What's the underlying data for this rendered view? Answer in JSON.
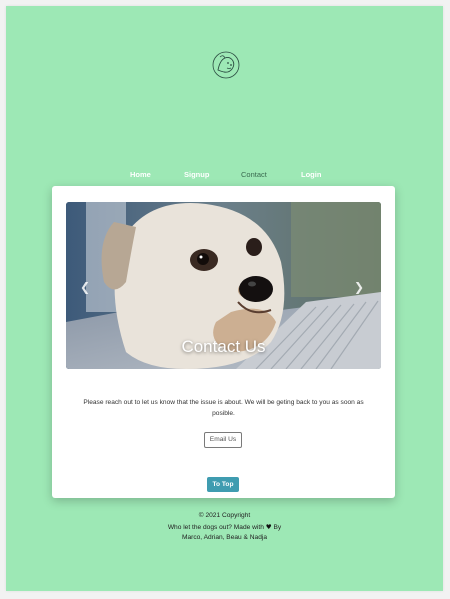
{
  "nav": {
    "items": [
      "Home",
      "Signup",
      "Contact",
      "Login"
    ],
    "active": "Contact"
  },
  "carousel": {
    "caption": "Contact Us",
    "prev_icon": "chevron-left-icon",
    "next_icon": "chevron-right-icon"
  },
  "contact": {
    "message_line1": "Please reach out to let us know that the issue is about. We will be geting back to you as soon as",
    "message_line2": "posible.",
    "email_button": "Email Us",
    "to_top_button": "To Top"
  },
  "footer": {
    "copyright": "© 2021 Copyright",
    "made_with_prefix": "Who let the dogs out? Made with",
    "heart": "♥",
    "made_with_suffix": "By",
    "authors": "Marco, Adrian, Beau & Nadja"
  },
  "colors": {
    "background": "#9de8b5",
    "card": "#ffffff",
    "accent_button": "#3f9cb0",
    "active_nav": "#3a6b50"
  },
  "logo": {
    "icon": "dog-logo-icon"
  }
}
